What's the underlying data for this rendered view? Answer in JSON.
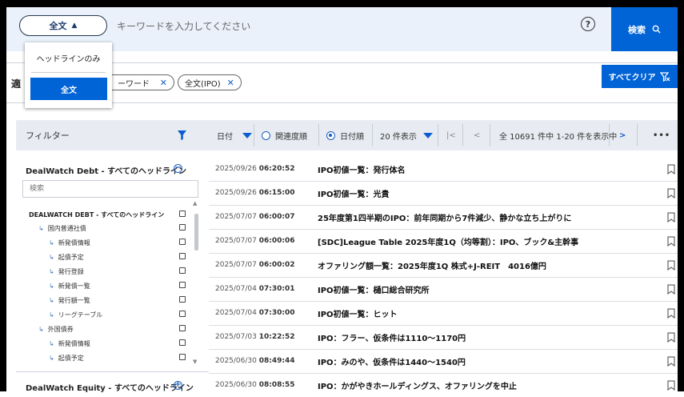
{
  "search": {
    "scope_label": "全文",
    "placeholder": "キーワードを入力してください",
    "help": "?",
    "button_label": "検索"
  },
  "scope_menu": {
    "options": [
      "ヘッドラインのみ",
      "全文"
    ],
    "selected": "全文"
  },
  "applied_filters": {
    "label": "適",
    "tags": [
      "ーワード",
      "全文(IPO)"
    ],
    "clear_all": "すべてクリア"
  },
  "filter_panel": {
    "title": "フィルター",
    "section1_title": "DealWatch Debt - すべてのヘッドライン",
    "search_placeholder": "検索",
    "tree": [
      {
        "label": "DEALWATCH DEBT - すべてのヘッドライン",
        "level": 0
      },
      {
        "label": "国内普通社債",
        "level": 1
      },
      {
        "label": "新発債情報",
        "level": 2
      },
      {
        "label": "起債予定",
        "level": 2
      },
      {
        "label": "発行登録",
        "level": 2
      },
      {
        "label": "新発債一覧",
        "level": 2
      },
      {
        "label": "発行額一覧",
        "level": 2
      },
      {
        "label": "リーグテーブル",
        "level": 2
      },
      {
        "label": "外国債券",
        "level": 1
      },
      {
        "label": "新発債情報",
        "level": 2
      },
      {
        "label": "起債予定",
        "level": 2
      }
    ],
    "section2_title": "DealWatch Equity - すべてのヘッドライン"
  },
  "toolbar": {
    "sort_label": "日付",
    "relevance_label": "関連度順",
    "date_order_label": "日付順",
    "per_page_label": "20 件表示",
    "first_label": "|<",
    "prev_label": "<",
    "page_info": "全 10691 件中 1-20 件を表示中",
    "next_label": ">",
    "more_label": "•••"
  },
  "results": [
    {
      "date": "2025/09/26",
      "time": "06:20:52",
      "title": "IPO初値一覧：発行体名"
    },
    {
      "date": "2025/09/26",
      "time": "06:15:00",
      "title": "IPO初値一覧：光貴"
    },
    {
      "date": "2025/07/07",
      "time": "06:00:07",
      "title": "25年度第1四半期のIPO：前年同期から7件減少、静かな立ち上がりに"
    },
    {
      "date": "2025/07/07",
      "time": "06:00:06",
      "title": "[SDC]League Table 2025年度1Q（均等割）：IPO、ブック&主幹事"
    },
    {
      "date": "2025/07/07",
      "time": "06:00:02",
      "title": "オファリング額一覧：2025年度1Q 株式+J-REIT　4016億円"
    },
    {
      "date": "2025/07/04",
      "time": "07:30:01",
      "title": "IPO初値一覧：樋口総合研究所"
    },
    {
      "date": "2025/07/04",
      "time": "07:30:00",
      "title": "IPO初値一覧：ヒット"
    },
    {
      "date": "2025/07/03",
      "time": "10:22:52",
      "title": "IPO：フラー、仮条件は1110～1170円"
    },
    {
      "date": "2025/06/30",
      "time": "08:49:44",
      "title": "IPO：みのや、仮条件は1440～1540円"
    },
    {
      "date": "2025/06/30",
      "time": "08:08:55",
      "title": "IPO：かがやきホールディングス、オファリングを中止"
    }
  ],
  "colors": {
    "accent": "#0063d6",
    "panel": "#e8ecf2",
    "search_bg": "#eaf1fa"
  }
}
